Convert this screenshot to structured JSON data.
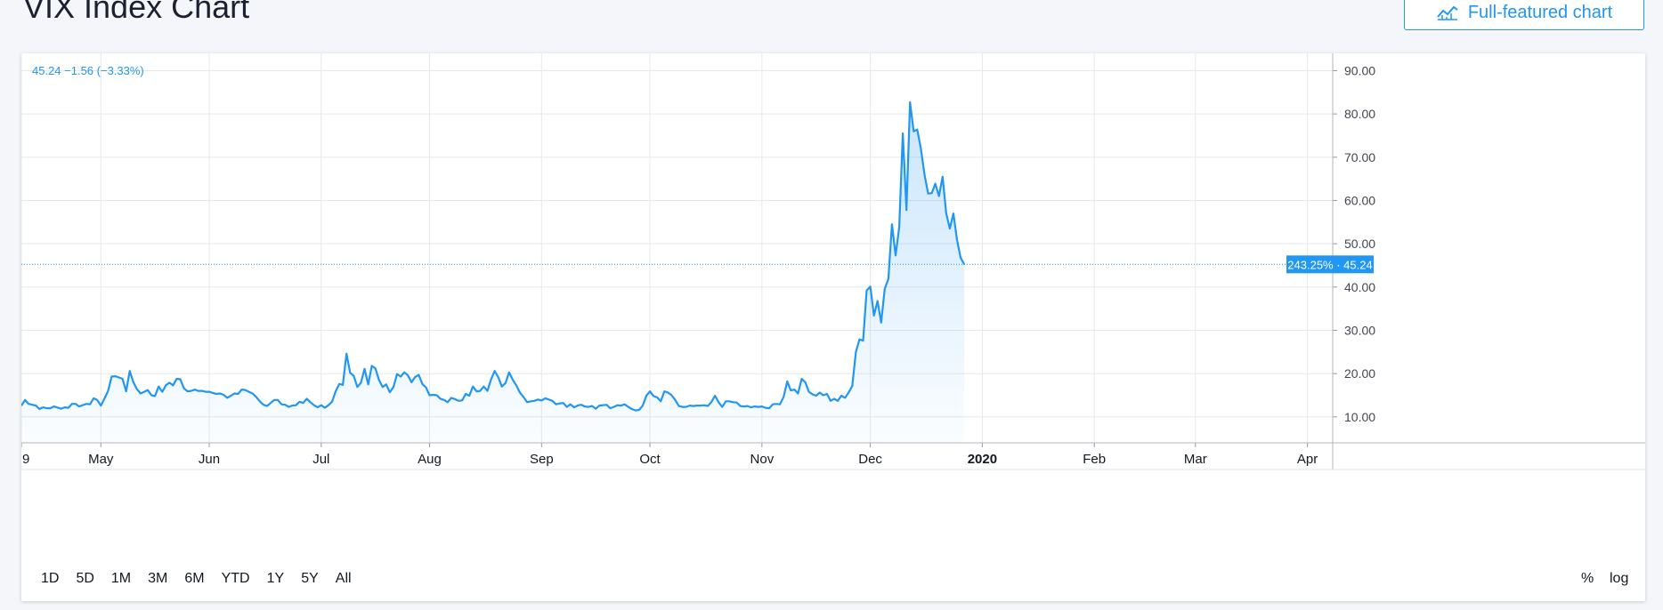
{
  "page": {
    "title": "VIX Index Chart"
  },
  "toolbar": {
    "full_chart_label": "Full-featured chart",
    "full_chart_icon": "chart-line-icon"
  },
  "legend": {
    "text": "45.24 −1.56 (−3.33%)"
  },
  "last_price": {
    "label": "243.25% · 45.24",
    "value": 45.24,
    "color": "#2196f3"
  },
  "ranges": [
    "1D",
    "5D",
    "1M",
    "3M",
    "6M",
    "YTD",
    "1Y",
    "5Y",
    "All"
  ],
  "scale_buttons": {
    "percent": "%",
    "log": "log"
  },
  "colors": {
    "line": "#2196f3",
    "fill": "#2196f3",
    "grid": "#e6e8ec"
  },
  "chart_data": {
    "type": "area",
    "title": "VIX Index Chart",
    "y_ticks": [
      "90.00",
      "80.00",
      "70.00",
      "60.00",
      "50.00",
      "40.00",
      "30.00",
      "20.00",
      "10.00"
    ],
    "ylim": [
      4,
      94
    ],
    "x_tick_labels": [
      "9",
      "May",
      "Jun",
      "Jul",
      "Aug",
      "Sep",
      "Oct",
      "Nov",
      "Dec",
      "2020",
      "Feb",
      "Mar",
      "Apr"
    ],
    "x_tick_days": [
      0,
      22,
      52,
      83,
      113,
      144,
      174,
      205,
      235,
      266,
      297,
      325,
      356
    ],
    "grid": true,
    "series": [
      {
        "values": [
          [
            0,
            12.6
          ],
          [
            1,
            13.9
          ],
          [
            2,
            13.0
          ],
          [
            4,
            12.6
          ],
          [
            5,
            11.8
          ],
          [
            6,
            12.2
          ],
          [
            7,
            12.0
          ],
          [
            8,
            12.0
          ],
          [
            9,
            12.4
          ],
          [
            11,
            11.9
          ],
          [
            12,
            12.2
          ],
          [
            13,
            12.1
          ],
          [
            14,
            13.0
          ],
          [
            15,
            13.0
          ],
          [
            16,
            12.4
          ],
          [
            18,
            13.0
          ],
          [
            19,
            12.9
          ],
          [
            20,
            14.3
          ],
          [
            21,
            13.9
          ],
          [
            22,
            12.6
          ],
          [
            23,
            14.2
          ],
          [
            24,
            16.0
          ],
          [
            25,
            19.3
          ],
          [
            26,
            19.4
          ],
          [
            27,
            19.1
          ],
          [
            28,
            18.8
          ],
          [
            29,
            15.9
          ],
          [
            30,
            20.6
          ],
          [
            31,
            18.0
          ],
          [
            32,
            16.4
          ],
          [
            33,
            15.4
          ],
          [
            34,
            15.8
          ],
          [
            35,
            16.2
          ],
          [
            36,
            15.0
          ],
          [
            37,
            14.8
          ],
          [
            38,
            17.0
          ],
          [
            39,
            15.8
          ],
          [
            40,
            17.3
          ],
          [
            41,
            17.9
          ],
          [
            42,
            17.3
          ],
          [
            43,
            18.8
          ],
          [
            44,
            18.7
          ],
          [
            45,
            16.6
          ],
          [
            46,
            15.9
          ],
          [
            47,
            16.0
          ],
          [
            48,
            16.3
          ],
          [
            49,
            16.0
          ],
          [
            50,
            16.0
          ],
          [
            51,
            15.8
          ],
          [
            52,
            15.8
          ],
          [
            53,
            15.5
          ],
          [
            54,
            15.3
          ],
          [
            55,
            15.4
          ],
          [
            56,
            15.1
          ],
          [
            57,
            14.4
          ],
          [
            58,
            14.9
          ],
          [
            59,
            15.4
          ],
          [
            60,
            15.3
          ],
          [
            61,
            16.3
          ],
          [
            62,
            16.2
          ],
          [
            63,
            15.8
          ],
          [
            64,
            15.4
          ],
          [
            65,
            14.6
          ],
          [
            66,
            13.6
          ],
          [
            67,
            12.8
          ],
          [
            68,
            12.5
          ],
          [
            69,
            13.2
          ],
          [
            70,
            13.9
          ],
          [
            71,
            13.9
          ],
          [
            72,
            12.9
          ],
          [
            73,
            12.8
          ],
          [
            74,
            12.3
          ],
          [
            75,
            12.6
          ],
          [
            76,
            12.7
          ],
          [
            77,
            13.5
          ],
          [
            78,
            13.2
          ],
          [
            79,
            14.2
          ],
          [
            80,
            13.4
          ],
          [
            81,
            12.7
          ],
          [
            82,
            12.2
          ],
          [
            83,
            12.7
          ],
          [
            84,
            12.1
          ],
          [
            85,
            12.7
          ],
          [
            86,
            13.5
          ],
          [
            87,
            15.9
          ],
          [
            88,
            17.6
          ],
          [
            89,
            17.4
          ],
          [
            90,
            24.6
          ],
          [
            91,
            20.2
          ],
          [
            92,
            19.5
          ],
          [
            93,
            16.9
          ],
          [
            94,
            17.9
          ],
          [
            95,
            21.1
          ],
          [
            96,
            17.5
          ],
          [
            97,
            21.8
          ],
          [
            98,
            21.2
          ],
          [
            99,
            18.5
          ],
          [
            100,
            16.9
          ],
          [
            101,
            17.5
          ],
          [
            102,
            15.7
          ],
          [
            103,
            16.9
          ],
          [
            104,
            19.9
          ],
          [
            105,
            19.3
          ],
          [
            106,
            20.3
          ],
          [
            107,
            19.6
          ],
          [
            108,
            18.0
          ],
          [
            109,
            19.2
          ],
          [
            110,
            19.7
          ],
          [
            111,
            17.6
          ],
          [
            112,
            16.8
          ],
          [
            113,
            15.0
          ],
          [
            114,
            15.1
          ],
          [
            115,
            15.0
          ],
          [
            116,
            14.2
          ],
          [
            117,
            13.9
          ],
          [
            118,
            13.4
          ],
          [
            119,
            14.4
          ],
          [
            120,
            14.1
          ],
          [
            121,
            13.7
          ],
          [
            122,
            13.8
          ],
          [
            123,
            15.3
          ],
          [
            124,
            14.9
          ],
          [
            125,
            17.0
          ],
          [
            126,
            15.9
          ],
          [
            127,
            16.0
          ],
          [
            128,
            17.0
          ],
          [
            129,
            16.0
          ],
          [
            130,
            18.6
          ],
          [
            131,
            20.6
          ],
          [
            132,
            19.2
          ],
          [
            133,
            17.0
          ],
          [
            134,
            17.8
          ],
          [
            135,
            20.3
          ],
          [
            136,
            18.6
          ],
          [
            137,
            17.3
          ],
          [
            138,
            15.6
          ],
          [
            139,
            14.6
          ],
          [
            140,
            13.4
          ],
          [
            141,
            13.6
          ],
          [
            142,
            13.7
          ],
          [
            143,
            14.0
          ],
          [
            144,
            13.8
          ],
          [
            145,
            14.3
          ],
          [
            146,
            14.0
          ],
          [
            147,
            13.7
          ],
          [
            148,
            12.9
          ],
          [
            149,
            13.1
          ],
          [
            150,
            13.2
          ],
          [
            151,
            12.3
          ],
          [
            152,
            12.9
          ],
          [
            153,
            12.2
          ],
          [
            154,
            12.6
          ],
          [
            155,
            12.8
          ],
          [
            156,
            12.4
          ],
          [
            157,
            12.3
          ],
          [
            158,
            12.5
          ],
          [
            159,
            11.9
          ],
          [
            160,
            12.6
          ],
          [
            161,
            12.7
          ],
          [
            162,
            12.8
          ],
          [
            163,
            12.0
          ],
          [
            164,
            12.3
          ],
          [
            165,
            12.7
          ],
          [
            166,
            12.6
          ],
          [
            167,
            12.9
          ],
          [
            168,
            12.3
          ],
          [
            169,
            11.8
          ],
          [
            170,
            11.5
          ],
          [
            171,
            11.6
          ],
          [
            172,
            12.6
          ],
          [
            173,
            14.9
          ],
          [
            174,
            15.9
          ],
          [
            175,
            14.8
          ],
          [
            176,
            14.5
          ],
          [
            177,
            13.6
          ],
          [
            178,
            15.9
          ],
          [
            179,
            15.6
          ],
          [
            180,
            15.0
          ],
          [
            181,
            13.9
          ],
          [
            182,
            12.5
          ],
          [
            183,
            12.3
          ],
          [
            184,
            12.3
          ],
          [
            185,
            12.6
          ],
          [
            186,
            12.5
          ],
          [
            187,
            12.6
          ],
          [
            188,
            12.6
          ],
          [
            189,
            12.7
          ],
          [
            190,
            12.5
          ],
          [
            191,
            13.4
          ],
          [
            192,
            14.9
          ],
          [
            193,
            13.4
          ],
          [
            194,
            12.3
          ],
          [
            195,
            13.6
          ],
          [
            196,
            13.6
          ],
          [
            197,
            13.4
          ],
          [
            198,
            13.3
          ],
          [
            199,
            12.5
          ],
          [
            200,
            12.4
          ],
          [
            201,
            12.5
          ],
          [
            202,
            12.2
          ],
          [
            203,
            12.4
          ],
          [
            204,
            12.3
          ],
          [
            205,
            12.4
          ],
          [
            206,
            12.1
          ],
          [
            207,
            12.0
          ],
          [
            208,
            12.9
          ],
          [
            209,
            13.0
          ],
          [
            210,
            12.9
          ],
          [
            211,
            14.6
          ],
          [
            212,
            18.2
          ],
          [
            213,
            16.1
          ],
          [
            214,
            16.3
          ],
          [
            215,
            15.4
          ],
          [
            216,
            18.8
          ],
          [
            217,
            18.0
          ],
          [
            218,
            15.8
          ],
          [
            219,
            15.2
          ],
          [
            220,
            14.9
          ],
          [
            221,
            15.6
          ],
          [
            222,
            15.0
          ],
          [
            223,
            15.3
          ],
          [
            224,
            13.7
          ],
          [
            225,
            14.2
          ],
          [
            226,
            13.7
          ],
          [
            227,
            14.9
          ],
          [
            228,
            14.4
          ],
          [
            229,
            15.6
          ],
          [
            230,
            17.1
          ],
          [
            231,
            25.0
          ],
          [
            232,
            27.9
          ],
          [
            233,
            27.6
          ],
          [
            234,
            39.2
          ],
          [
            235,
            40.1
          ],
          [
            236,
            33.4
          ],
          [
            237,
            36.8
          ],
          [
            238,
            31.8
          ],
          [
            239,
            39.6
          ],
          [
            240,
            41.9
          ],
          [
            241,
            54.5
          ],
          [
            242,
            47.3
          ],
          [
            243,
            53.9
          ],
          [
            244,
            75.5
          ],
          [
            245,
            57.8
          ],
          [
            246,
            82.7
          ],
          [
            247,
            76.0
          ],
          [
            248,
            76.4
          ],
          [
            249,
            72.0
          ],
          [
            250,
            66.0
          ],
          [
            251,
            61.6
          ],
          [
            252,
            61.7
          ],
          [
            253,
            63.9
          ],
          [
            254,
            61.0
          ],
          [
            255,
            65.5
          ],
          [
            256,
            57.1
          ],
          [
            257,
            53.5
          ],
          [
            258,
            57.0
          ],
          [
            259,
            50.9
          ],
          [
            260,
            46.8
          ],
          [
            261,
            45.24
          ]
        ]
      }
    ]
  }
}
